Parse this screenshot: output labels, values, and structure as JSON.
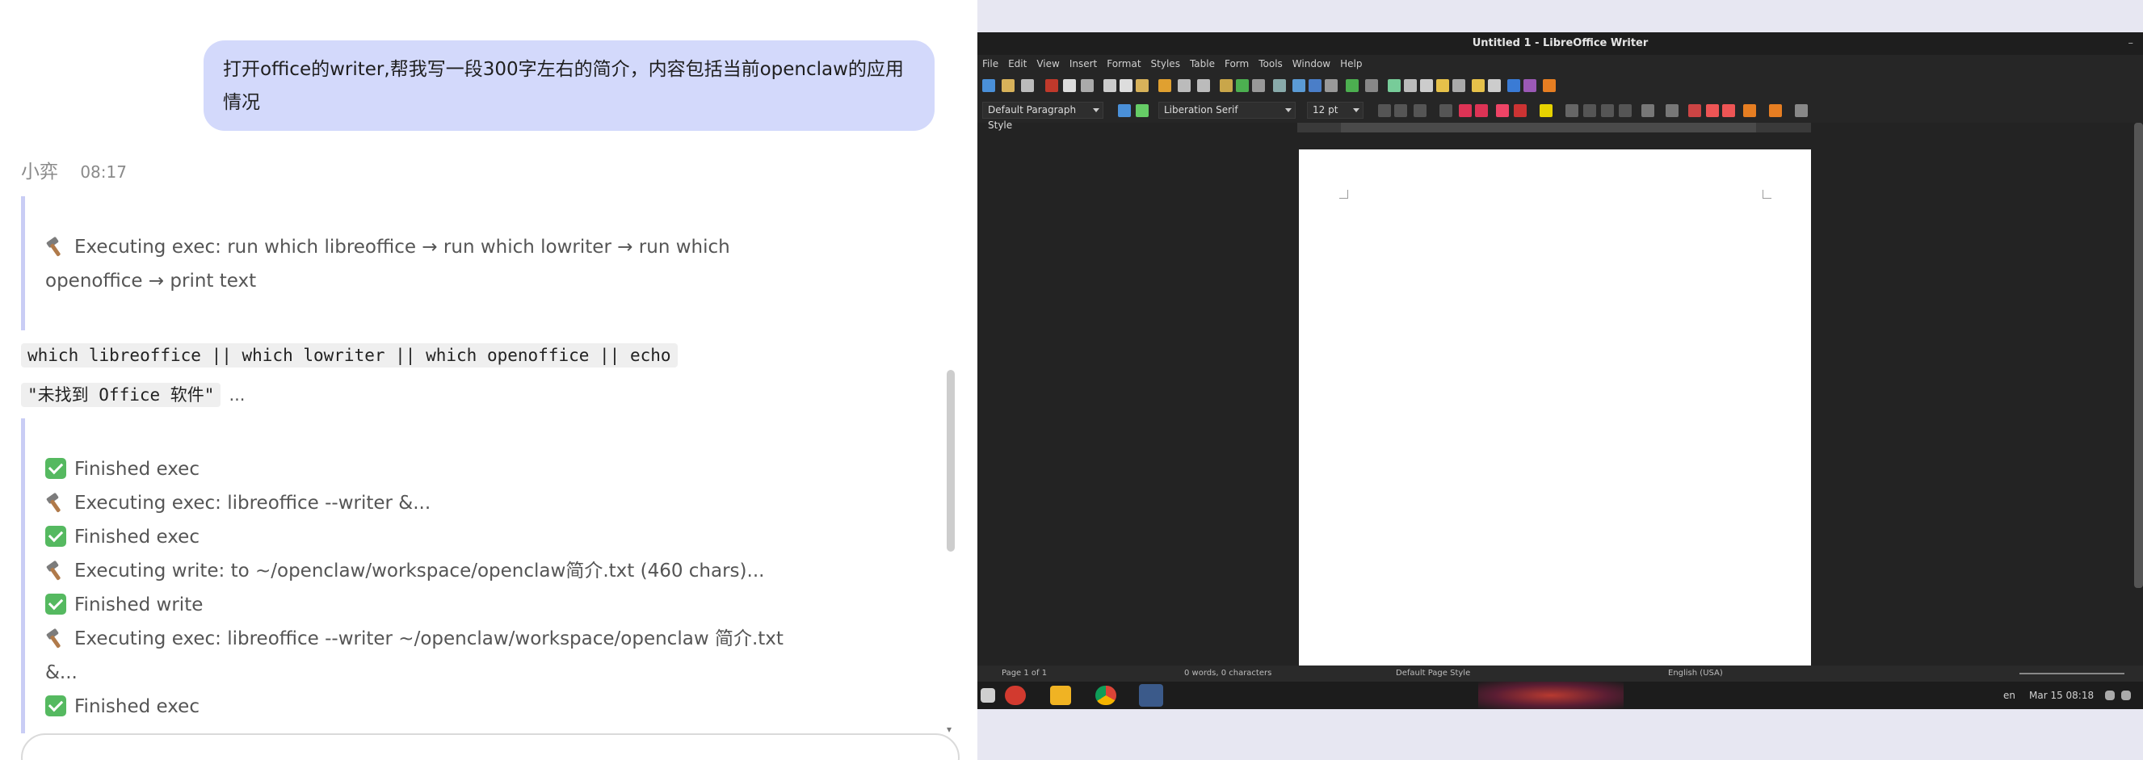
{
  "chat": {
    "user_message_line1": "打开office的writer,帮我写一段300字左右的简介，内容包括当前openclaw的应用",
    "user_message_line2": "情况",
    "assistant_name": "小弈",
    "assistant_time": "08:17",
    "block1": {
      "line1": "Executing exec: run which libreoffice → run which lowriter → run which",
      "line2": "openoffice → print text"
    },
    "code": {
      "line1": "which libreoffice || which lowriter || which openoffice || echo",
      "line2": "\"未找到 Office 软件\"",
      "ellipsis": "..."
    },
    "block2": [
      {
        "icon": "check-icon",
        "text": "Finished exec"
      },
      {
        "icon": "hammer-icon",
        "text": "Executing exec: libreoffice --writer &..."
      },
      {
        "icon": "check-icon",
        "text": "Finished exec"
      },
      {
        "icon": "hammer-icon",
        "text": "Executing write: to ~/openclaw/workspace/openclaw简介.txt (460 chars)..."
      },
      {
        "icon": "check-icon",
        "text": "Finished write"
      },
      {
        "icon": "hammer-icon",
        "text": "Executing exec: libreoffice --writer ~/openclaw/workspace/openclaw 简介.txt"
      },
      {
        "icon": "none",
        "text": "&..."
      },
      {
        "icon": "check-icon",
        "text": "Finished exec"
      }
    ]
  },
  "writer": {
    "window_title": "Untitled 1 - LibreOffice Writer",
    "menu": [
      "File",
      "Edit",
      "View",
      "Insert",
      "Format",
      "Styles",
      "Table",
      "Form",
      "Tools",
      "Window",
      "Help"
    ],
    "paragraph_style": "Default Paragraph Style",
    "font_name": "Liberation Serif",
    "font_size": "12 pt",
    "status": {
      "page": "Page 1 of 1",
      "words": "0 words, 0 characters",
      "page_style": "Default Page Style",
      "language": "English (USA)"
    }
  },
  "taskbar": {
    "keyboard": "en",
    "datetime": "Mar 15 08:18"
  },
  "colors": {
    "user_bubble": "#d3d9fb",
    "tool_border": "#c9cdf5",
    "check_green": "#55b960"
  }
}
